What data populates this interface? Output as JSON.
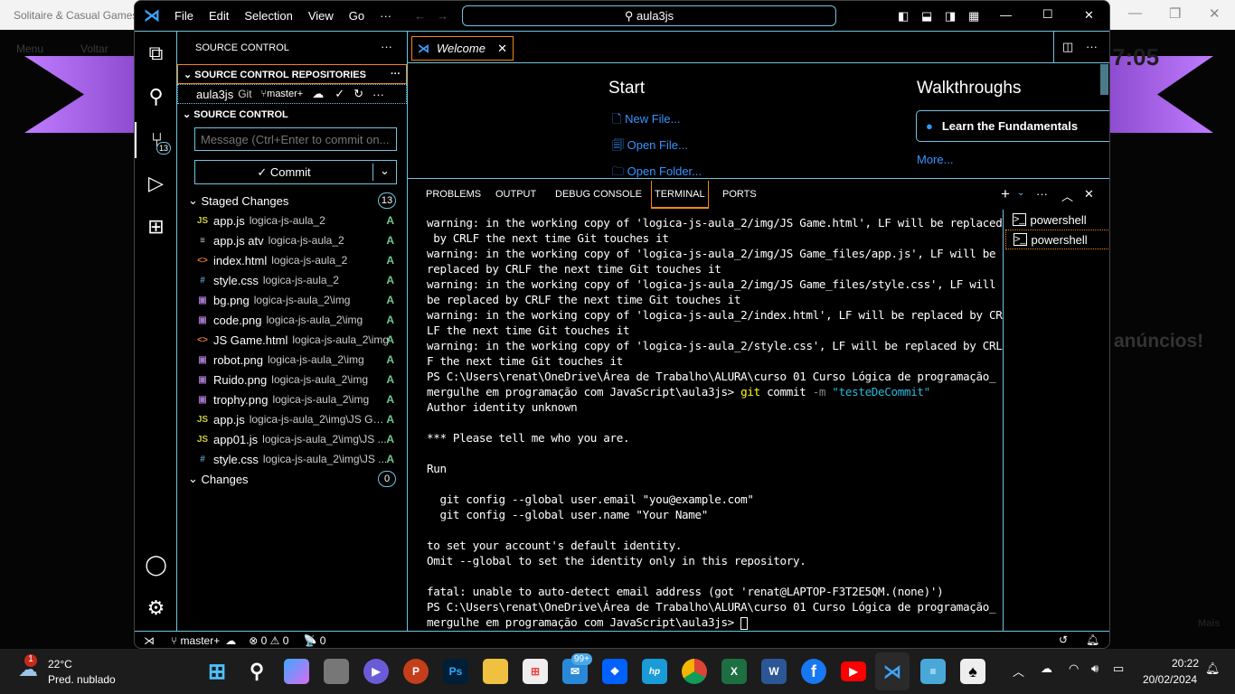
{
  "background_app": {
    "title": "Solitaire & Casual Games",
    "menu_label": "Menu",
    "back_label": "Voltar",
    "timer": "7:05",
    "ads_text": "anúncios!",
    "more_label": "Mais"
  },
  "titlebar": {
    "menus": [
      "File",
      "Edit",
      "Selection",
      "View",
      "Go",
      "···"
    ],
    "search": "aula3js"
  },
  "activity": {
    "scm_badge": "13"
  },
  "sidebar": {
    "title": "SOURCE CONTROL",
    "repos_header": "SOURCE CONTROL REPOSITORIES",
    "repo": {
      "name": "aula3js",
      "type": "Git",
      "branch": "master+"
    },
    "scm_header": "SOURCE CONTROL",
    "message_placeholder": "Message (Ctrl+Enter to commit on...",
    "commit_label": "Commit",
    "staged": {
      "label": "Staged Changes",
      "count": "13",
      "files": [
        {
          "name": "app.js",
          "dir": "logica-js-aula_2",
          "status": "A",
          "icon": "js"
        },
        {
          "name": "app.js atv",
          "dir": "logica-js-aula_2",
          "status": "A",
          "icon": "text"
        },
        {
          "name": "index.html",
          "dir": "logica-js-aula_2",
          "status": "A",
          "icon": "html"
        },
        {
          "name": "style.css",
          "dir": "logica-js-aula_2",
          "status": "A",
          "icon": "css"
        },
        {
          "name": "bg.png",
          "dir": "logica-js-aula_2\\img",
          "status": "A",
          "icon": "image"
        },
        {
          "name": "code.png",
          "dir": "logica-js-aula_2\\img",
          "status": "A",
          "icon": "image"
        },
        {
          "name": "JS Game.html",
          "dir": "logica-js-aula_2\\img",
          "status": "A",
          "icon": "html"
        },
        {
          "name": "robot.png",
          "dir": "logica-js-aula_2\\img",
          "status": "A",
          "icon": "image"
        },
        {
          "name": "Ruido.png",
          "dir": "logica-js-aula_2\\img",
          "status": "A",
          "icon": "image"
        },
        {
          "name": "trophy.png",
          "dir": "logica-js-aula_2\\img",
          "status": "A",
          "icon": "image"
        },
        {
          "name": "app.js",
          "dir": "logica-js-aula_2\\img\\JS Ga...",
          "status": "A",
          "icon": "js"
        },
        {
          "name": "app01.js",
          "dir": "logica-js-aula_2\\img\\JS ...",
          "status": "A",
          "icon": "js"
        },
        {
          "name": "style.css",
          "dir": "logica-js-aula_2\\img\\JS ...",
          "status": "A",
          "icon": "css"
        }
      ]
    },
    "changes": {
      "label": "Changes",
      "count": "0"
    }
  },
  "editor": {
    "tab": "Welcome",
    "start": "Start",
    "new_file": "New File...",
    "open_file": "Open File...",
    "open_folder": "Open Folder...",
    "walkthroughs": "Walkthroughs",
    "learn": "Learn the Fundamentals",
    "more": "More..."
  },
  "panel": {
    "tabs": [
      "PROBLEMS",
      "OUTPUT",
      "DEBUG CONSOLE",
      "TERMINAL",
      "PORTS"
    ],
    "active_tab": "TERMINAL",
    "terminals": [
      "powershell",
      "powershell"
    ],
    "lines": [
      "warning: in the working copy of 'logica-js-aula_2/img/JS Game.html', LF will be replaced",
      " by CRLF the next time Git touches it",
      "warning: in the working copy of 'logica-js-aula_2/img/JS Game_files/app.js', LF will be",
      "replaced by CRLF the next time Git touches it",
      "warning: in the working copy of 'logica-js-aula_2/img/JS Game_files/style.css', LF will",
      "be replaced by CRLF the next time Git touches it",
      "warning: in the working copy of 'logica-js-aula_2/index.html', LF will be replaced by CR",
      "LF the next time Git touches it",
      "warning: in the working copy of 'logica-js-aula_2/style.css', LF will be replaced by CRL",
      "F the next time Git touches it",
      "PS C:\\Users\\renat\\OneDrive\\Área de Trabalho\\ALURA\\curso 01 Curso Lógica de programação_",
      "mergulhe em programação com JavaScript\\aula3js> ",
      "Author identity unknown",
      "",
      "*** Please tell me who you are.",
      "",
      "Run",
      "",
      "  git config --global user.email \"you@example.com\"",
      "  git config --global user.name \"Your Name\"",
      "",
      "to set your account's default identity.",
      "Omit --global to set the identity only in this repository.",
      "",
      "fatal: unable to auto-detect email address (got 'renat@LAPTOP-F3T2E5QM.(none)')",
      "PS C:\\Users\\renat\\OneDrive\\Área de Trabalho\\ALURA\\curso 01 Curso Lógica de programação_",
      "mergulhe em programação com JavaScript\\aula3js> "
    ],
    "cmd": {
      "git": "git",
      "sub": " commit ",
      "flag": "-m ",
      "arg": "\"testeDeCommit\""
    }
  },
  "status": {
    "branch": "master+",
    "errors": "0",
    "warnings": "0",
    "ports": "0"
  },
  "taskbar": {
    "temp": "22°C",
    "weather": "Pred. nublado",
    "weather_badge": "1",
    "mail_badge": "99+",
    "time": "20:22",
    "date": "20/02/2024"
  },
  "colors": {
    "border": "#6fc3df",
    "focus": "#f38518",
    "link": "#3794ff",
    "added": "#73c991"
  }
}
